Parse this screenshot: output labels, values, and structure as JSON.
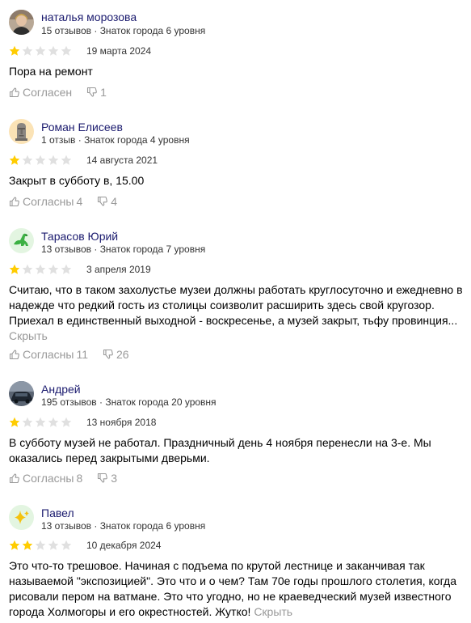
{
  "reviews": [
    {
      "name": "наталья морозова",
      "reviews_count": "15 отзывов",
      "level": "Знаток города 6 уровня",
      "rating": 1,
      "date": "19 марта 2024",
      "text": "Пора на ремонт",
      "more": "",
      "agree_label": "Согласен",
      "agree_count": "",
      "dislike_count": "1",
      "avatar": "photo-avatar"
    },
    {
      "name": "Роман Елисеев",
      "reviews_count": "1 отзыв",
      "level": "Знаток города 4 уровня",
      "rating": 1,
      "date": "14 августа 2021",
      "text": "Закрыт в субботу в, 15.00",
      "more": "",
      "agree_label": "Согласны",
      "agree_count": "4",
      "dislike_count": "4",
      "avatar": "moai-avatar"
    },
    {
      "name": "Тарасов Юрий",
      "reviews_count": "13 отзывов",
      "level": "Знаток города 7 уровня",
      "rating": 1,
      "date": "3 апреля 2019",
      "text": "Считаю, что в таком захолустье музеи должны работать круглосуточно и ежедневно в надежде что редкий гость из столицы соизволит расширить здесь свой кругозор. Приехал в единственный выходной - воскресенье, а музей закрыт, тьфу провинция...",
      "more": "Скрыть",
      "agree_label": "Согласны",
      "agree_count": "11",
      "dislike_count": "26",
      "avatar": "dinosaur-avatar"
    },
    {
      "name": "Андрей",
      "reviews_count": "195 отзывов",
      "level": "Знаток города 20 уровня",
      "rating": 1,
      "date": "13 ноября 2018",
      "text": "В субботу музей не работал. Праздничный день 4 ноября перенесли на 3-е. Мы оказались перед закрытыми дверьми.",
      "more": "",
      "agree_label": "Согласны",
      "agree_count": "8",
      "dislike_count": "3",
      "avatar": "car-photo-avatar"
    },
    {
      "name": "Павел",
      "reviews_count": "13 отзывов",
      "level": "Знаток города 6 уровня",
      "rating": 2,
      "date": "10 декабря 2024",
      "text": "Это что-то трешовое. Начиная с подъема по крутой лестнице и заканчивая так называемой \"экспозицией\". Это что и о чем? Там 70е годы прошлого столетия, когда рисовали пером на ватмане. Это что угодно, но не краеведческий музей известного города Холмогоры и его окрестностей. Жутко!",
      "more": "Скрыть",
      "agree_label": "",
      "agree_count": "",
      "dislike_count": "",
      "avatar": "sparkles-avatar"
    }
  ],
  "colors": {
    "star_filled": "#fc0",
    "star_empty": "#e0e0e0",
    "name": "#1a1a6e",
    "muted": "#999999"
  }
}
